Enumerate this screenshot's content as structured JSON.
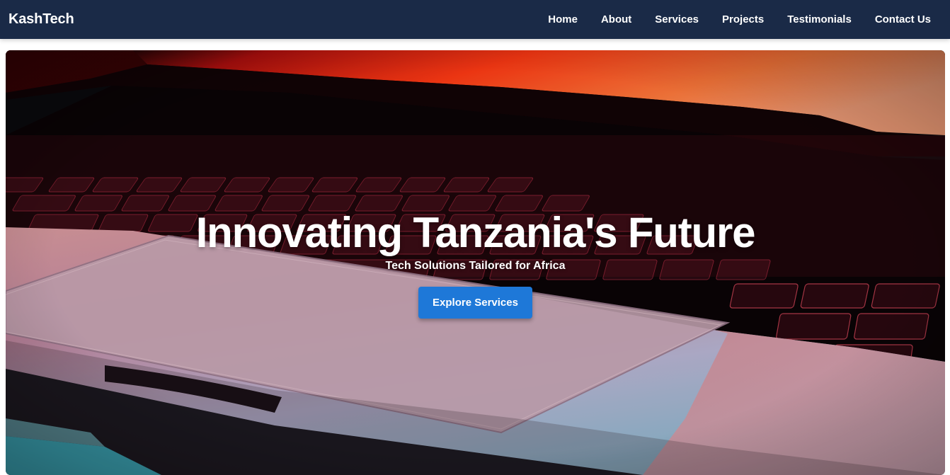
{
  "nav": {
    "brand": "KashTech",
    "links": [
      "Home",
      "About",
      "Services",
      "Projects",
      "Testimonials",
      "Contact Us"
    ]
  },
  "hero": {
    "background_icon": "laptop-keyboard-photo",
    "title": "Innovating Tanzania's Future",
    "subtitle": "Tech Solutions Tailored for Africa",
    "cta_label": "Explore Services"
  },
  "colors": {
    "navbar": "#1a2a47",
    "button": "#1e78d8",
    "text": "#ffffff"
  }
}
